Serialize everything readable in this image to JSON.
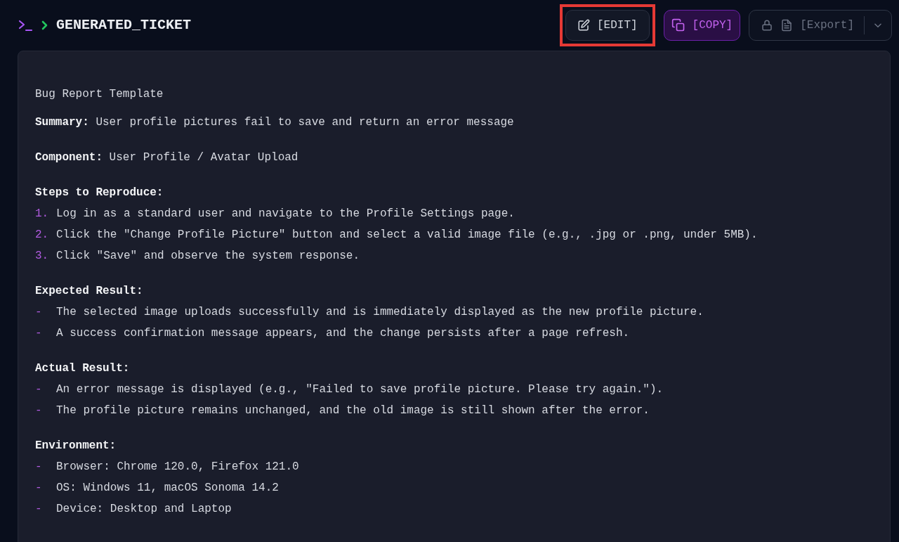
{
  "header": {
    "title": "GENERATED_TICKET"
  },
  "toolbar": [
    {
      "kind": "edit",
      "label": "[EDIT]",
      "highlighted": true
    },
    {
      "kind": "copy",
      "label": "[COPY]",
      "highlighted": false
    },
    {
      "kind": "export",
      "label": "[Export]",
      "highlighted": false
    }
  ],
  "document": {
    "heading": "Bug Report Template",
    "sections": [
      {
        "kind": "field",
        "label": "Summary:",
        "value": "User profile pictures fail to save and return an error message"
      },
      {
        "kind": "field",
        "label": "Component:",
        "value": "User Profile / Avatar Upload"
      },
      {
        "kind": "list",
        "title": "Steps to Reproduce:",
        "items": [
          {
            "marker": "1.",
            "text": "Log in as a standard user and navigate to the Profile Settings page."
          },
          {
            "marker": "2.",
            "text": "Click the \"Change Profile Picture\" button and select a valid image file (e.g., .jpg or .png, under 5MB)."
          },
          {
            "marker": "3.",
            "text": "Click \"Save\" and observe the system response."
          }
        ]
      },
      {
        "kind": "list",
        "title": "Expected Result:",
        "items": [
          {
            "marker": "-",
            "text": "The selected image uploads successfully and is immediately displayed as the new profile picture."
          },
          {
            "marker": "-",
            "text": "A success confirmation message appears, and the change persists after a page refresh."
          }
        ]
      },
      {
        "kind": "list",
        "title": "Actual Result:",
        "items": [
          {
            "marker": "-",
            "text": "An error message is displayed (e.g., \"Failed to save profile picture. Please try again.\")."
          },
          {
            "marker": "-",
            "text": "The profile picture remains unchanged, and the old image is still shown after the error."
          }
        ]
      },
      {
        "kind": "list",
        "title": "Environment:",
        "items": [
          {
            "marker": "-",
            "text": "Browser: Chrome 120.0, Firefox 121.0"
          },
          {
            "marker": "-",
            "text": "OS: Windows 11, macOS Sonoma 14.2"
          },
          {
            "marker": "-",
            "text": "Device: Desktop and Laptop"
          }
        ]
      }
    ]
  }
}
